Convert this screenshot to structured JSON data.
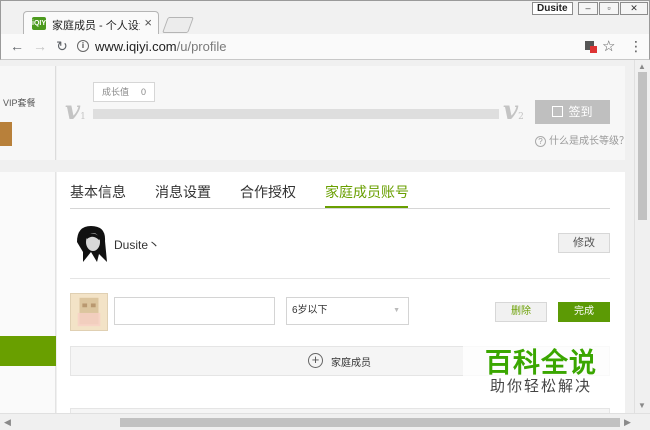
{
  "browser": {
    "tab_title": "家庭成员 - 个人设置 - 爱",
    "tab_favicon_text": "iQIYI",
    "profile_name": "Dusite",
    "url_host": "www.iqiyi.com",
    "url_path": "/u/profile"
  },
  "top": {
    "vip_text": "VIP套餐",
    "growth_label": "成长值",
    "growth_value": "0",
    "level_current": "1",
    "level_next": "2",
    "progress_fraction": 0,
    "signin_label": "签到",
    "level_help": "什么是成长等级？"
  },
  "tabs": [
    {
      "label": "基本信息",
      "active": false
    },
    {
      "label": "消息设置",
      "active": false
    },
    {
      "label": "合作授权",
      "active": false
    },
    {
      "label": "家庭成员账号",
      "active": true
    }
  ],
  "account": {
    "username": "Dusite丶",
    "edit_label": "修改"
  },
  "member": {
    "name_value": "",
    "name_placeholder": "",
    "age_value": "6岁以下",
    "delete_label": "删除",
    "done_label": "完成"
  },
  "add_member_label": "家庭成员",
  "watermark": {
    "main": "百科全说",
    "sub": "助你轻松解决"
  },
  "colors": {
    "accent": "#699f00",
    "progress": "#00be06",
    "watermark": "#3aa600"
  }
}
